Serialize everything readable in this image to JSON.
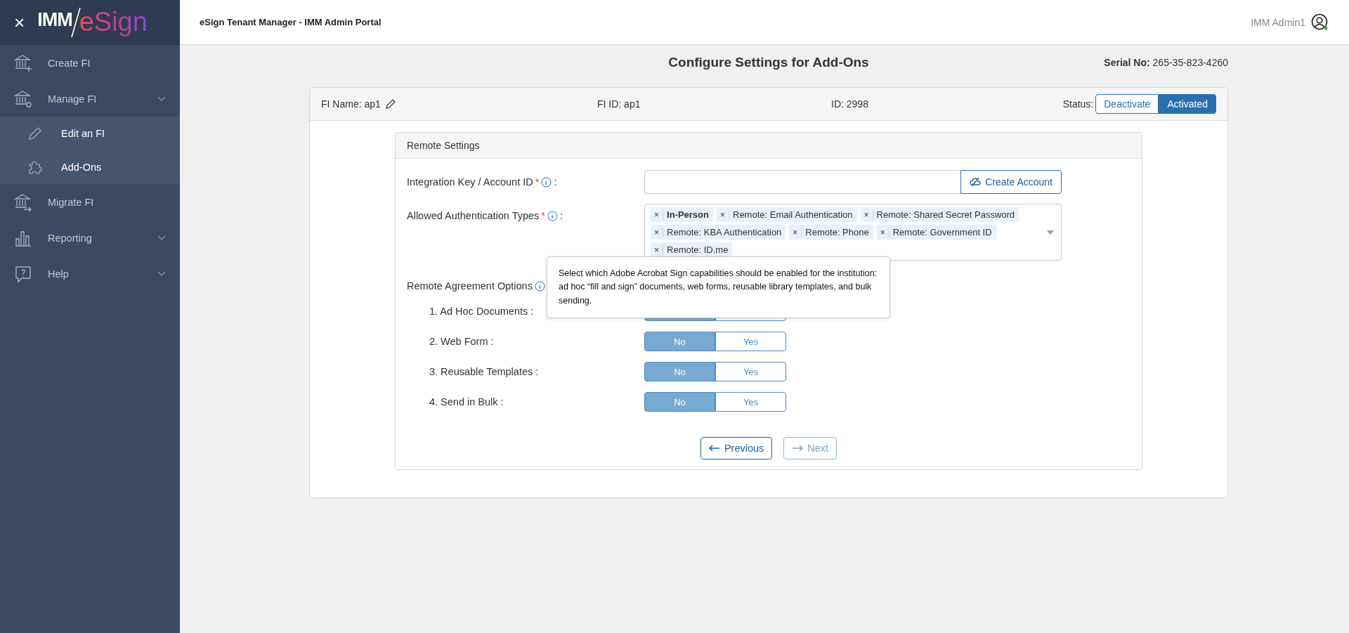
{
  "sidebar": {
    "close": "×",
    "logo": {
      "left": "IMM",
      "right": "eSign"
    },
    "items": [
      {
        "label": "Create FI",
        "expandable": false
      },
      {
        "label": "Manage FI",
        "expandable": true,
        "children": [
          {
            "label": "Edit an FI"
          },
          {
            "label": "Add-Ons"
          }
        ]
      },
      {
        "label": "Migrate FI",
        "expandable": false
      },
      {
        "label": "Reporting",
        "expandable": true
      },
      {
        "label": "Help",
        "expandable": true
      }
    ]
  },
  "header": {
    "title": "eSign Tenant Manager - IMM Admin Portal",
    "user": "IMM Admin1"
  },
  "page": {
    "title": "Configure Settings for Add-Ons",
    "serial_label": "Serial No:",
    "serial": "265-35-823-4260"
  },
  "card": {
    "fi_name": "FI Name: ap1",
    "fi_id": "FI ID: ap1",
    "id": "ID: 2998",
    "status_label": "Status:",
    "status": [
      {
        "label": "Deactivate",
        "selected": false
      },
      {
        "label": "Activated",
        "selected": true
      }
    ]
  },
  "panel": {
    "title": "Remote Settings",
    "integration": {
      "label": "Integration Key / Account ID",
      "required_mark": "*",
      "suffix": ":",
      "button": "Create Account"
    },
    "auth": {
      "label": "Allowed Authentication Types",
      "required_mark": "*",
      "suffix": ":",
      "remove": "×",
      "tags": [
        {
          "label": "In-Person",
          "emphasized": true
        },
        {
          "label": "Remote: Email Authentication",
          "emphasized": false
        },
        {
          "label": "Remote: Shared Secret Password",
          "emphasized": false
        },
        {
          "label": "Remote: KBA Authentication",
          "emphasized": false
        },
        {
          "label": "Remote: Phone",
          "emphasized": false
        },
        {
          "label": "Remote: Government ID",
          "emphasized": false
        },
        {
          "label": "Remote: ID.me",
          "emphasized": false
        }
      ]
    },
    "options_label": "Remote Agreement Options",
    "tooltip": "Select which Adobe Acrobat Sign capabilities should be enabled for the institution: ad hoc “fill and sign” documents, web forms, reusable library templates, and bulk sending.",
    "options": [
      {
        "label": "1. Ad Hoc Documents :",
        "choices": [
          {
            "selected": true
          },
          {
            "selected": false
          }
        ]
      },
      {
        "label": "2. Web Form :",
        "choices": [
          {
            "label": "No",
            "selected": true
          },
          {
            "label": "Yes",
            "selected": false
          }
        ]
      },
      {
        "label": "3. Reusable Templates :",
        "choices": [
          {
            "label": "No",
            "selected": true
          },
          {
            "label": "Yes",
            "selected": false
          }
        ]
      },
      {
        "label": "4. Send in Bulk :",
        "choices": [
          {
            "label": "No",
            "selected": true
          },
          {
            "label": "Yes",
            "selected": false
          }
        ]
      }
    ],
    "previous": "Previous",
    "next": "Next"
  }
}
